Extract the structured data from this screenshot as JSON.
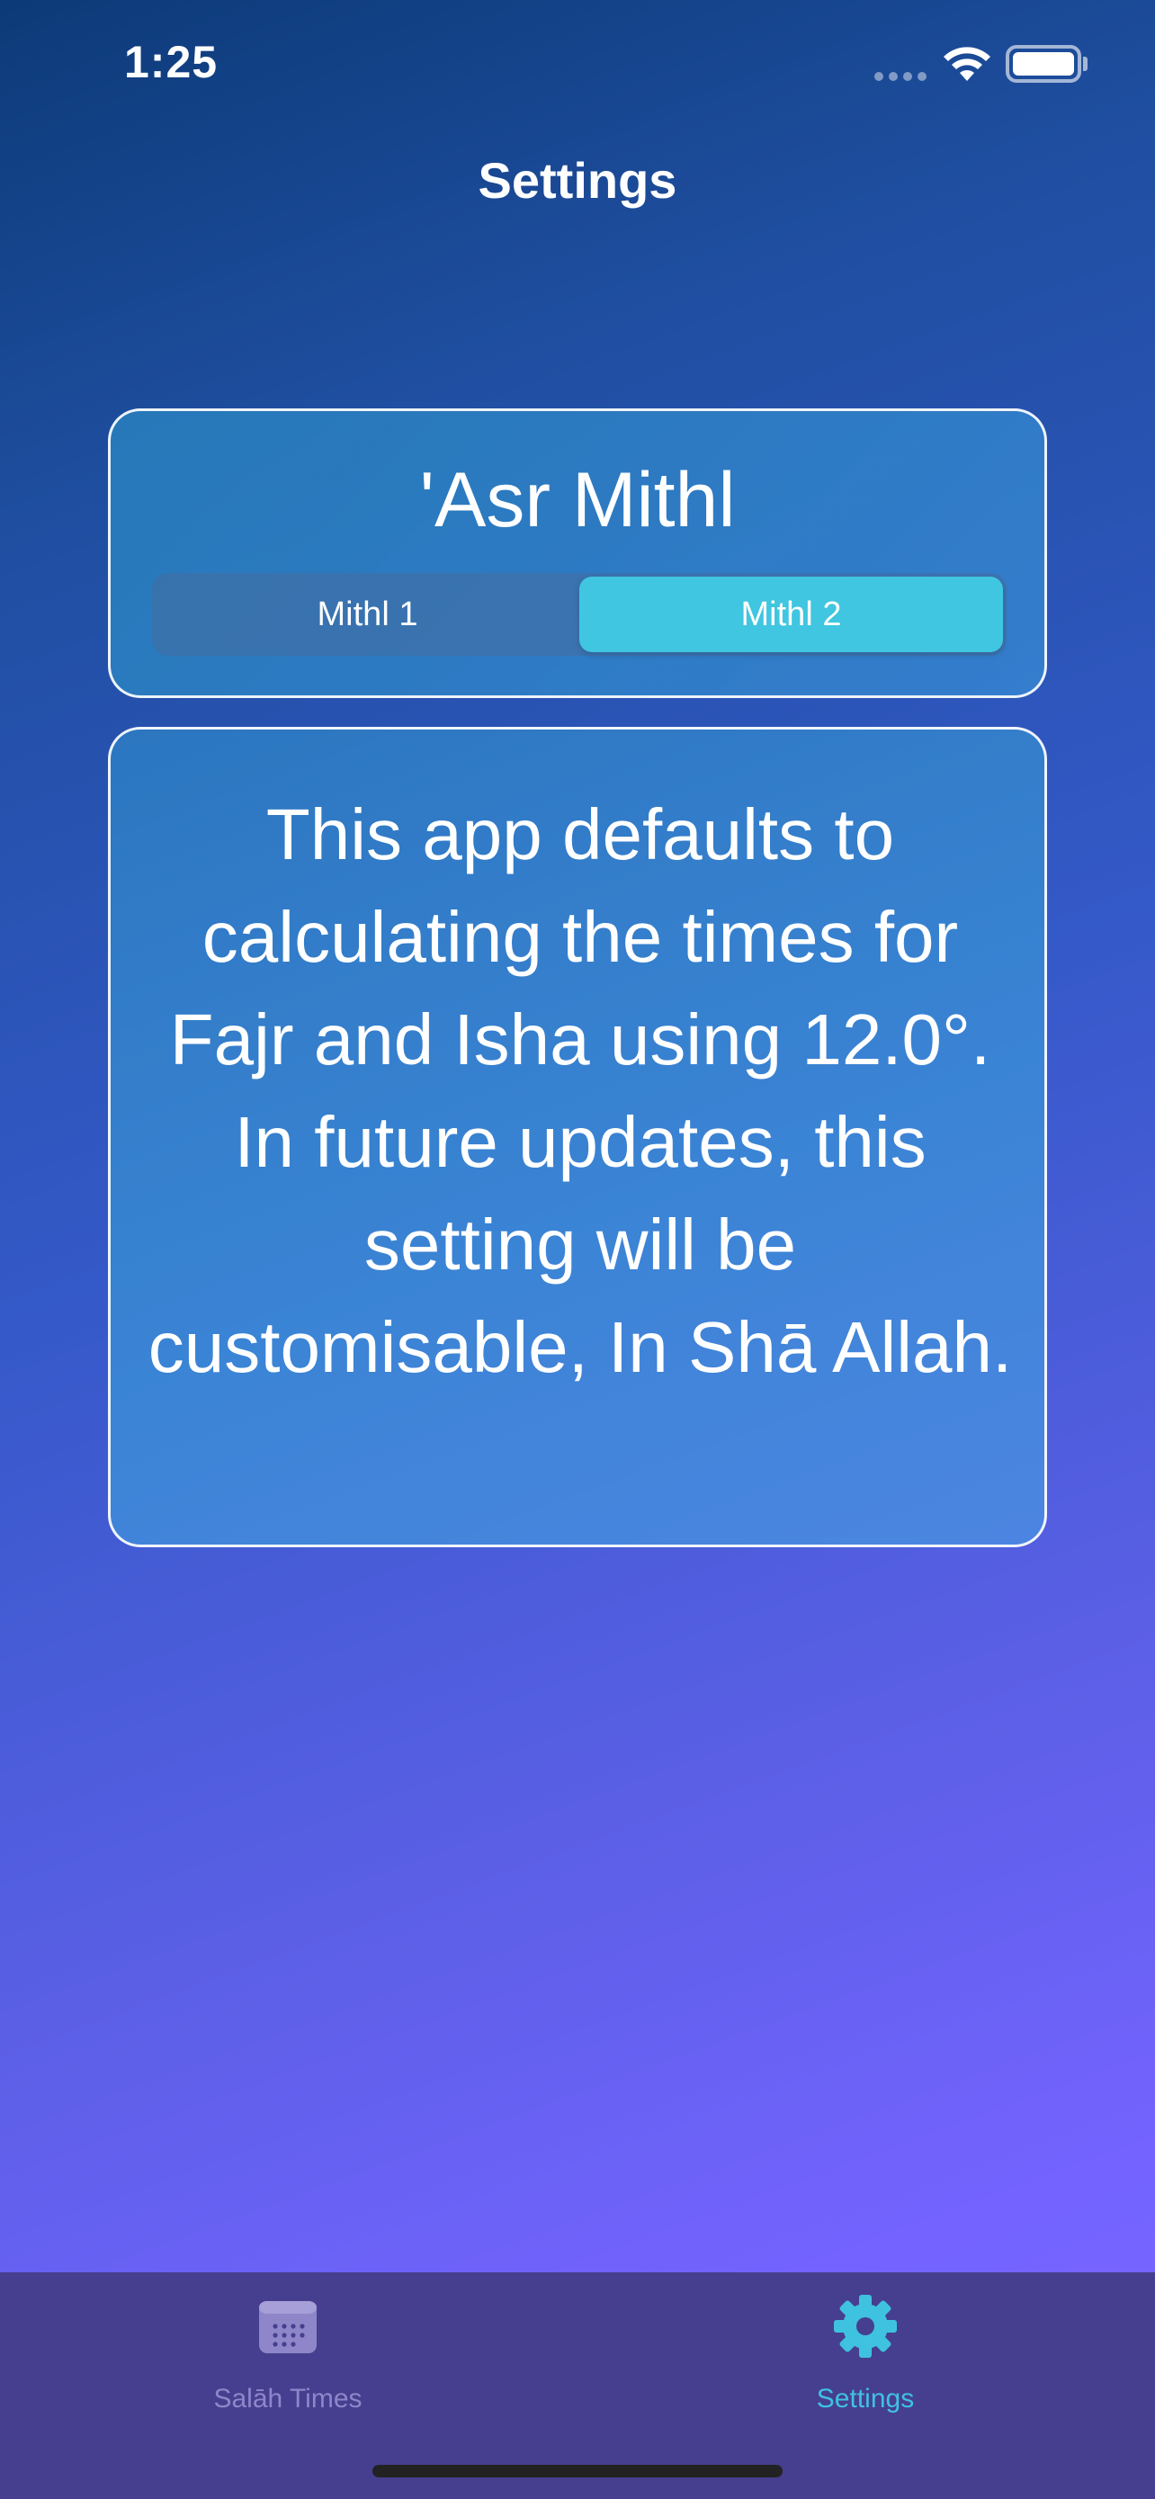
{
  "status_bar": {
    "time": "1:25"
  },
  "header": {
    "title": "Settings"
  },
  "asr_card": {
    "title": "'Asr Mithl",
    "options": [
      "Mithl 1",
      "Mithl 2"
    ],
    "selected": "Mithl 2"
  },
  "info_card": {
    "text": "This app defaults to calculating the times for Fajr and Isha using 12.0°. In future updates, this setting will be customisable, In Shā Allah."
  },
  "tab_bar": {
    "tabs": [
      {
        "label": "Salāh Times",
        "icon": "calendar-icon",
        "active": false
      },
      {
        "label": "Settings",
        "icon": "gear-icon",
        "active": true
      }
    ]
  },
  "colors": {
    "accent": "#40c6e0",
    "tab_bar": "#463f8f",
    "inactive_tab": "#8f86c9"
  }
}
